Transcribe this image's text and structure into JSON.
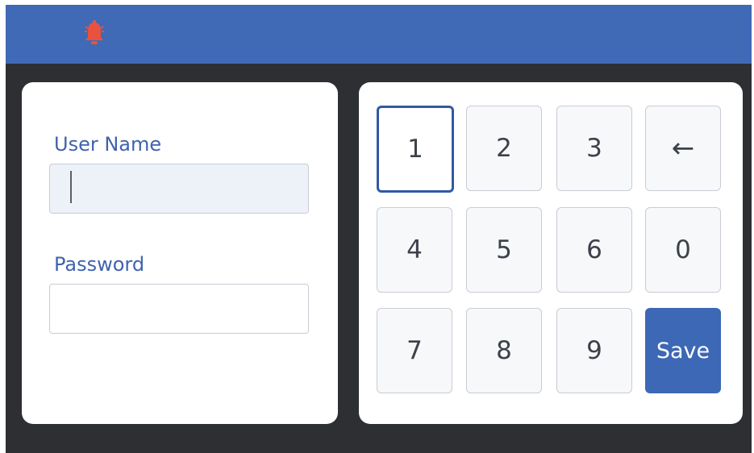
{
  "colors": {
    "topbar": "#4069b6",
    "background": "#2d2f33",
    "accent": "#3c68b5",
    "label_text": "#3f63ad",
    "alarm": "#e8523f"
  },
  "header": {
    "alarm_icon": "alarm-bell-icon"
  },
  "login": {
    "username_label": "User Name",
    "username_value": "",
    "password_label": "Password",
    "password_value": ""
  },
  "keypad": {
    "keys": [
      "1",
      "2",
      "3",
      "←",
      "4",
      "5",
      "6",
      "0",
      "7",
      "8",
      "9",
      "Save"
    ],
    "selected_key": "1"
  }
}
